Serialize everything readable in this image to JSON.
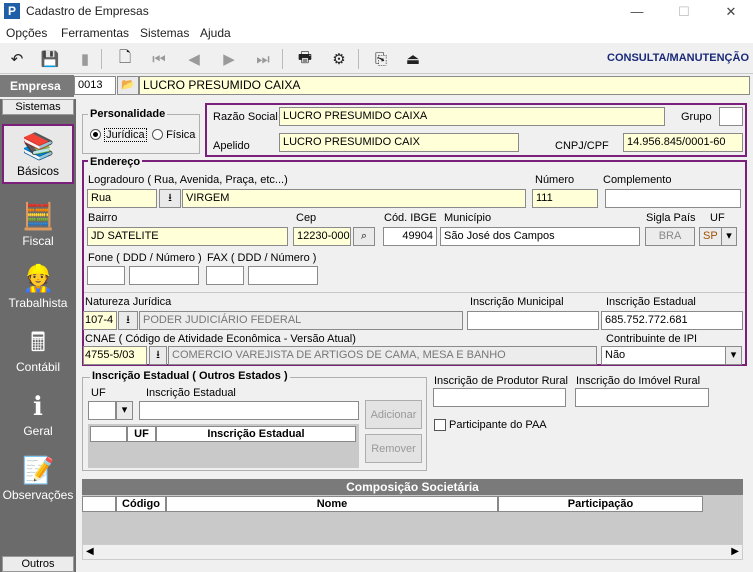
{
  "window": {
    "title": "Cadastro de Empresas",
    "icon_letter": "P"
  },
  "window_controls": {
    "minimize": "—",
    "maximize": "☐",
    "close": "✕"
  },
  "menu": {
    "items": [
      "Opções",
      "Ferramentas",
      "Sistemas",
      "Ajuda"
    ]
  },
  "toolbar": {
    "mode_label": "CONSULTA/MANUTENÇÃO",
    "icons": [
      "undo-icon",
      "save-icon",
      "delete-icon",
      "preview-icon",
      "first-record-icon",
      "previous-record-icon",
      "next-record-icon",
      "last-record-icon",
      "print-icon",
      "print-setup-icon",
      "export-icon",
      "exit-icon"
    ]
  },
  "empresa": {
    "label": "Empresa",
    "code": "0013",
    "name": "LUCRO PRESUMIDO CAIXA"
  },
  "sidebar": {
    "header": "Sistemas",
    "footer": "Outros",
    "items": [
      {
        "label": "Básicos",
        "icon": "books-icon"
      },
      {
        "label": "Fiscal",
        "icon": "calculator-icon"
      },
      {
        "label": "Trabalhista",
        "icon": "worker-icon"
      },
      {
        "label": "Contábil",
        "icon": "ledger-icon"
      },
      {
        "label": "Geral",
        "icon": "info-icon"
      },
      {
        "label": "Observações",
        "icon": "notes-icon"
      }
    ]
  },
  "personalidade": {
    "title": "Personalidade",
    "juridica": "Jurídica",
    "fisica": "Física",
    "selected": "Jurídica"
  },
  "identificacao": {
    "razao_social_label": "Razão Social",
    "razao_social": "LUCRO PRESUMIDO CAIXA",
    "grupo_label": "Grupo",
    "grupo": "",
    "apelido_label": "Apelido",
    "apelido": "LUCRO PRESUMIDO CAIX",
    "cnpj_label": "CNPJ/CPF",
    "cnpj": "14.956.845/0001-60"
  },
  "endereco": {
    "title": "Endereço",
    "logradouro_label": "Logradouro ( Rua, Avenida, Praça, etc...)",
    "tipo": "Rua",
    "logradouro": "VIRGEM",
    "numero_label": "Número",
    "numero": "111",
    "complemento_label": "Complemento",
    "complemento": "",
    "bairro_label": "Bairro",
    "bairro": "JD SATELITE",
    "cep_label": "Cep",
    "cep": "12230-000",
    "cod_ibge_label": "Cód. IBGE",
    "cod_ibge": "49904",
    "municipio_label": "Município",
    "municipio": "São José dos Campos",
    "sigla_pais_label": "Sigla País",
    "sigla_pais": "BRA",
    "uf_label": "UF",
    "uf": "SP",
    "fone_label": "Fone ( DDD / Número )",
    "fax_label": "FAX ( DDD / Número )",
    "natureza_label": "Natureza Jurídica",
    "natureza_code": "107-4",
    "natureza_desc": "PODER JUDICIÁRIO FEDERAL",
    "insc_municipal_label": "Inscrição Municipal",
    "insc_municipal": "",
    "insc_estadual_label": "Inscrição Estadual",
    "insc_estadual": "685.752.772.681",
    "cnae_label": "CNAE ( Código de Atividade Econômica - Versão Atual)",
    "cnae_code": "4755-5/03",
    "cnae_desc": "COMERCIO VAREJISTA DE ARTIGOS DE CAMA, MESA E BANHO",
    "ipi_label": "Contribuinte de IPI",
    "ipi": "Não"
  },
  "outros_estados": {
    "title": "Inscrição Estadual ( Outros Estados )",
    "uf_label": "UF",
    "insc_label": "Inscrição Estadual",
    "add_button": "Adicionar",
    "remove_button": "Remover",
    "col_uf": "UF",
    "col_insc": "Inscrição Estadual"
  },
  "rural": {
    "produtor_label": "Inscrição de Produtor Rural",
    "imovel_label": "Inscrição do Imóvel Rural",
    "paa_label": "Participante do PAA"
  },
  "composicao": {
    "title": "Composição Societária",
    "col_codigo": "Código",
    "col_nome": "Nome",
    "col_participacao": "Participação"
  }
}
